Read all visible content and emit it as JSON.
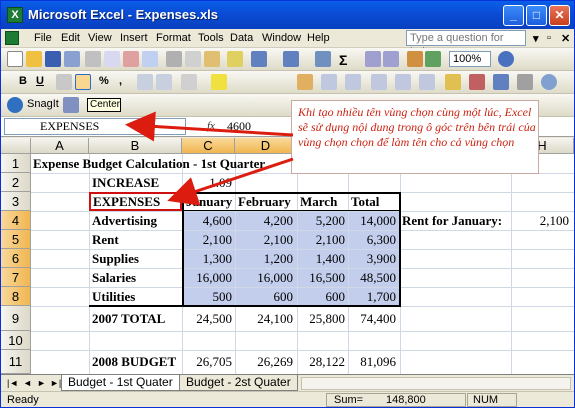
{
  "window": {
    "title": "Microsoft Excel - Expenses.xls",
    "min": "_",
    "max": "□",
    "close": "✕"
  },
  "menu": {
    "items": [
      "File",
      "Edit",
      "View",
      "Insert",
      "Format",
      "Tools",
      "Data",
      "Window",
      "Help"
    ],
    "help_placeholder": "Type a question for help"
  },
  "toolbar": {
    "zoom": "100%",
    "sigma": "Σ"
  },
  "format_toolbar": {
    "bold": "B",
    "underline": "U",
    "percent": "%",
    "comma": ","
  },
  "snagit": {
    "label": "SnagIt"
  },
  "tooltip": "Center",
  "formula_bar": {
    "name_box": "EXPENSES",
    "fx": "fx",
    "value": "4600"
  },
  "columns": [
    "A",
    "B",
    "C",
    "D",
    "E",
    "F",
    "G",
    "H"
  ],
  "rows": [
    "1",
    "2",
    "3",
    "4",
    "5",
    "6",
    "7",
    "8",
    "9",
    "10",
    "11"
  ],
  "cells": {
    "a1": "Expense Budget Calculation - 1st Quarter",
    "b2": "INCREASE",
    "c2": "1.09",
    "b3": "EXPENSES",
    "c3": "January",
    "d3": "February",
    "e3": "March",
    "f3": "Total",
    "b4": "Advertising",
    "c4": "4,600",
    "d4": "4,200",
    "e4": "5,200",
    "f4": "14,000",
    "g4": "Rent for January:",
    "h4": "2,100",
    "b5": "Rent",
    "c5": "2,100",
    "d5": "2,100",
    "e5": "2,100",
    "f5": "6,300",
    "b6": "Supplies",
    "c6": "1,300",
    "d6": "1,200",
    "e6": "1,400",
    "f6": "3,900",
    "b7": "Salaries",
    "c7": "16,000",
    "d7": "16,000",
    "e7": "16,500",
    "f7": "48,500",
    "b8": "Utilities",
    "c8": "500",
    "d8": "600",
    "e8": "600",
    "f8": "1,700",
    "b9": "2007 TOTAL",
    "c9": "24,500",
    "d9": "24,100",
    "e9": "25,800",
    "f9": "74,400",
    "b11": "2008 BUDGET",
    "c11": "26,705",
    "d11": "26,269",
    "e11": "28,122",
    "f11": "81,096"
  },
  "sheet_tabs": {
    "nav": [
      "|◄",
      "◄",
      "►",
      "►|"
    ],
    "tab1": "Budget - 1st Quater",
    "tab2": "Budget - 2st Quater"
  },
  "status": {
    "ready": "Ready",
    "sum_label": "Sum=",
    "sum_value": "148,800",
    "num": "NUM"
  },
  "callout": "Khi tạo nhiều tên vùng chọn cùng một lúc, Excel sẽ sử dụng nội dung trong ô góc trên bên trái của vùng chọn chọn để làm tên cho cả vùng chọn",
  "colors": {
    "accent_red": "#cc2211",
    "selection": "#b8c6ea",
    "title_blue": "#0a4dd8"
  }
}
